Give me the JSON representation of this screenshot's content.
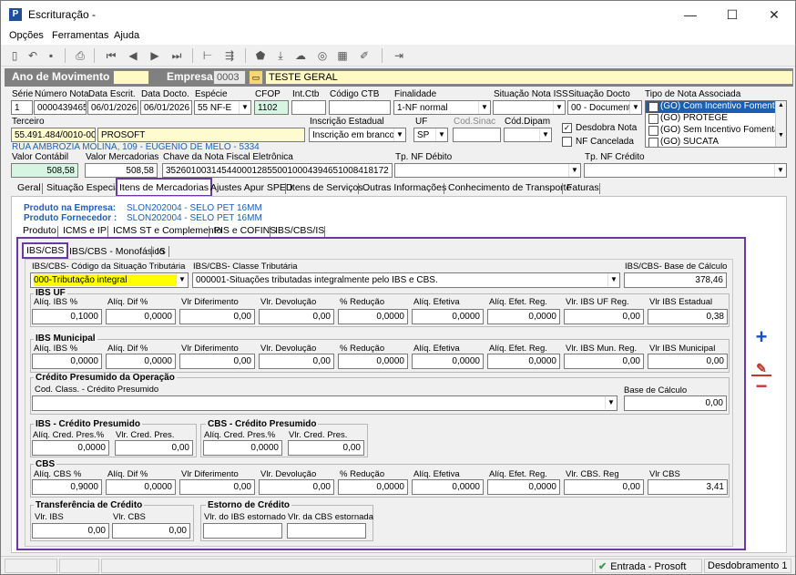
{
  "window": {
    "title": "Escrituração -",
    "minimize": "—",
    "maximize": "☐",
    "close": "✕"
  },
  "menu": [
    "Opções",
    "Ferramentas",
    "Ajuda"
  ],
  "header": {
    "ano_label": "Ano de Movimento",
    "ano_value": "",
    "empresa_label": "Empresa",
    "empresa_code": "0003",
    "empresa_name": "TESTE GERAL"
  },
  "nota": {
    "serie_label": "Série",
    "serie": "1",
    "numero_label": "Número Nota",
    "numero": "0000439465",
    "data_escrit_label": "Data Escrit.",
    "data_escrit": "06/01/2026",
    "data_docto_label": "Data Docto.",
    "data_docto": "06/01/2026",
    "especie_label": "Espécie",
    "especie": "55 NF-E",
    "cfop_label": "CFOP",
    "cfop": "1102",
    "intctb_label": "Int.Ctb",
    "intctb": "",
    "codctb_label": "Código CTB",
    "codctb": "",
    "finalidade_label": "Finalidade",
    "finalidade": "1-NF normal",
    "sit_iss_label": "Situação Nota ISS",
    "sit_iss": "",
    "sit_docto_label": "Situação Docto",
    "sit_docto": "00 - Document",
    "tipo_assoc_label": "Tipo de Nota Associada",
    "tipo_assoc_items": [
      "(GO) Com Incentivo Fomentar/",
      "(GO) PROTEGE",
      "(GO) Sem Incentivo Fomentar/",
      "(GO) SUCATA"
    ],
    "terceiro_label": "Terceiro",
    "terceiro_cnpj": "55.491.484/0010-00",
    "terceiro_nome": "PROSOFT",
    "endereco": "RUA AMBROZIA MOLINA, 109 - EUGENIO DE MELO - 5334",
    "ie_label": "Inscrição Estadual",
    "ie": "Inscrição em branco",
    "uf_label": "UF",
    "uf": "SP",
    "cod_sinac_label": "Cod.Sinac",
    "cod_dipam_label": "Cód.Dipam",
    "desdobra_label": "Desdobra Nota",
    "nf_cancelada_label": "NF Cancelada",
    "valor_contabil_label": "Valor Contábil",
    "valor_contabil": "508,58",
    "valor_merc_label": "Valor Mercadorias",
    "valor_merc": "508,58",
    "chave_label": "Chave da Nota Fiscal Eletrônica",
    "chave": "35260100314544000128550010004394651008418172",
    "tp_debito_label": "Tp. NF Débito",
    "tp_credito_label": "Tp. NF Crédito"
  },
  "main_tabs": [
    "Geral",
    "Situação Especial",
    "Itens de Mercadorias",
    "Ajustes Apur SPED",
    "Itens de Serviços",
    "Outras Informações",
    "Conhecimento de Transporte",
    "Faturas"
  ],
  "produto": {
    "empresa_label": "Produto na Empresa:",
    "empresa_value": "SLON202004 - SELO PET 16MM",
    "fornecedor_label": "Produto Fornecedor :",
    "fornecedor_value": "SLON202004 - SELO PET 16MM"
  },
  "sub_tabs": [
    "Produto",
    "ICMS e IPI",
    "ICMS ST e Complemento",
    "PIS e COFINS",
    "IBS/CBS/IS"
  ],
  "ibs_tabs": [
    "IBS/CBS",
    "IBS/CBS - Monofásico",
    "IS"
  ],
  "ibs": {
    "cst_label": "IBS/CBS- Código da Situação Tributária",
    "cst_value": "000-Tributação integral",
    "class_label": "IBS/CBS- Classe Tributária",
    "class_value": "000001-Situações tributadas integralmente pelo IBS e CBS.",
    "base_label": "IBS/CBS- Base de Cálculo",
    "base_value": "378,46",
    "uf": {
      "title": "IBS UF",
      "labels": [
        "Alíq. IBS %",
        "Alíq. Dif %",
        "Vlr Diferimento",
        "Vlr. Devolução",
        "% Redução",
        "Alíq. Efetiva",
        "Alíq. Efet. Reg.",
        "Vlr. IBS UF Reg.",
        "Vlr IBS Estadual"
      ],
      "values": [
        "0,1000",
        "0,0000",
        "0,00",
        "0,00",
        "0,0000",
        "0,0000",
        "0,0000",
        "0,00",
        "0,38"
      ]
    },
    "mun": {
      "title": "IBS Municipal",
      "labels": [
        "Alíq. IBS %",
        "Alíq. Dif %",
        "Vlr Diferimento",
        "Vlr. Devolução",
        "% Redução",
        "Alíq. Efetiva",
        "Alíq. Efet. Reg.",
        "Vlr. IBS Mun. Reg.",
        "Vlr IBS Municipal"
      ],
      "values": [
        "0,0000",
        "0,0000",
        "0,00",
        "0,00",
        "0,0000",
        "0,0000",
        "0,0000",
        "0,00",
        "0,00"
      ]
    },
    "credito": {
      "title": "Crédito Presumido da Operação",
      "cod_label": "Cod. Class. - Crédito Presumido",
      "cod_value": "",
      "base_label": "Base de Cálculo",
      "base_value": "0,00"
    },
    "ibs_cred": {
      "title": "IBS - Crédito Presumido",
      "labels": [
        "Alíq. Cred. Pres.%",
        "Vlr. Cred. Pres."
      ],
      "values": [
        "0,0000",
        "0,00"
      ]
    },
    "cbs_cred": {
      "title": "CBS - Crédito Presumido",
      "labels": [
        "Alíq. Cred. Pres.%",
        "Vlr. Cred. Pres."
      ],
      "values": [
        "0,0000",
        "0,00"
      ]
    },
    "cbs": {
      "title": "CBS",
      "labels": [
        "Alíq. CBS %",
        "Alíq. Dif %",
        "Vlr Diferimento",
        "Vlr. Devolução",
        "% Redução",
        "Alíq. Efetiva",
        "Alíq. Efet. Reg.",
        "Vlr. CBS. Reg",
        "Vlr CBS"
      ],
      "values": [
        "0,9000",
        "0,0000",
        "0,00",
        "0,00",
        "0,0000",
        "0,0000",
        "0,0000",
        "0,00",
        "3,41"
      ]
    },
    "transf": {
      "title": "Transferência de Crédito",
      "labels": [
        "Vlr. IBS",
        "Vlr. CBS"
      ],
      "values": [
        "0,00",
        "0,00"
      ]
    },
    "estorno": {
      "title": "Estorno de Crédito",
      "labels": [
        "Vlr. do IBS estornado",
        "Vlr. da CBS estornada"
      ],
      "values": [
        "",
        ""
      ]
    }
  },
  "side": {
    "add": "+",
    "edit": "✎",
    "remove": "−"
  },
  "status": {
    "entrada": "Entrada - Prosoft",
    "desdobramento": "Desdobramento 1"
  },
  "colors": {
    "purple": "#6a3aa0",
    "yellow_highlight": "#ffff00",
    "blue_text": "#1f5fb8"
  }
}
